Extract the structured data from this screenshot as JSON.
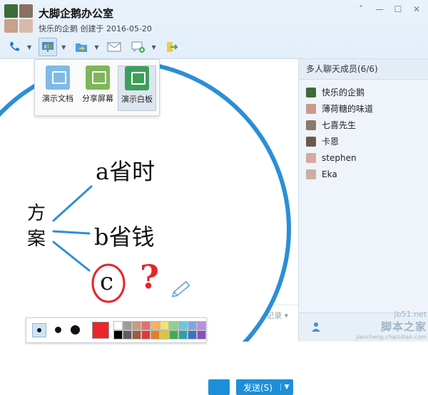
{
  "window": {
    "title": "大脚企鹅办公室",
    "subtitle": "快乐的企鹅 创建于 2016-05-20",
    "controls": [
      "˅",
      "—",
      "☐",
      "✕"
    ]
  },
  "toolbar": {
    "icons": [
      "phone-icon",
      "presentation-icon",
      "folder-transfer-icon",
      "mail-icon",
      "app-add-icon",
      "exit-icon"
    ]
  },
  "present_menu": {
    "items": [
      {
        "label": "演示文档",
        "icon": "doc-present-icon"
      },
      {
        "label": "分享屏幕",
        "icon": "share-screen-icon"
      },
      {
        "label": "演示白板",
        "icon": "whiteboard-icon",
        "selected": true
      }
    ]
  },
  "members_panel": {
    "header": "多人聊天成员(6/6)",
    "members": [
      "快乐的企鹅",
      "薄荷糖的味道",
      "七喜先生",
      "卡恩",
      "stephen",
      "Eka"
    ]
  },
  "whiteboard": {
    "handwriting": {
      "left": "方案",
      "a": "a省时",
      "b": "b省钱",
      "c": "c",
      "q": "?"
    }
  },
  "chat": {
    "history_link": "消息记录",
    "send_label": "发送(S)"
  },
  "palette": {
    "colors": [
      "#ffffff",
      "#9b9b9b",
      "#c99a7a",
      "#e07070",
      "#f2b36a",
      "#f2e36a",
      "#8fd18f",
      "#6ec7d6",
      "#7da7e0",
      "#b88fdc",
      "#000000",
      "#5c5c5c",
      "#a05a3a",
      "#e03a3a",
      "#e07f2a",
      "#e0c62a",
      "#3fae4f",
      "#2aa3a8",
      "#3a6fce",
      "#8a4ec0"
    ],
    "selected_color": "#e8262b"
  },
  "watermark": {
    "line1": "jb51.net",
    "line2": "脚本之家",
    "line3": "jiaocheng.chazidian.com"
  }
}
